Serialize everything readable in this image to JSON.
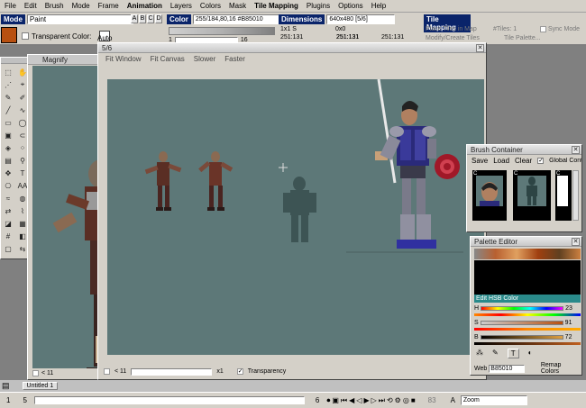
{
  "menu": [
    "File",
    "Edit",
    "Brush",
    "Mode",
    "Frame",
    "Animation",
    "Layers",
    "Colors",
    "Mask",
    "Tile Mapping",
    "Plugins",
    "Options",
    "Help"
  ],
  "toolbar": {
    "mode_label": "Mode",
    "mode_value": "Paint",
    "abcd": [
      "A",
      "B",
      "C",
      "D"
    ],
    "transparent_color": "Transparent Color:",
    "auto": "Auto",
    "color_label": "Color",
    "color_value": "255/184,80,16 #B85010",
    "color_index": "1",
    "color_count": "16",
    "dimensions_label": "Dimensions",
    "dimensions_value": "640x480 [5/6]",
    "brush_size": "1x1 S",
    "offset": "0x0",
    "coords": [
      "251:131",
      "251:131",
      "251:131",
      "251:131"
    ],
    "tilemapping_label": "Tile Mapping",
    "place_tiles": "Place Tiles in Map",
    "modify_tiles": "Modify/Create Tiles",
    "tiles_count": "#Tiles: 1",
    "tile_palette": "Tile Palette...",
    "sync_mode": "Sync Mode"
  },
  "magnify": {
    "title": "Magnify",
    "zoom": "< 11"
  },
  "canvas_window": {
    "title": "5/6",
    "menu": [
      "Fit Window",
      "Fit Canvas",
      "Slower",
      "Faster"
    ],
    "zoom": "< 11",
    "zoom_right": "x1",
    "transparency": "Transparency"
  },
  "brush_container": {
    "title": "Brush Container",
    "menu": [
      "Save",
      "Load",
      "Clear"
    ],
    "global": "Global Container",
    "slots": [
      "C",
      "C",
      "C"
    ]
  },
  "palette_editor": {
    "title": "Palette Editor",
    "hsb_label": "Edit HSB Color",
    "h_label": "H",
    "h_value": "23",
    "s_label": "S",
    "s_value": "91",
    "b_label": "B",
    "b_value": "72",
    "web_label": "Web",
    "web_value": "B85010",
    "remap": "Remap Colors"
  },
  "tab": {
    "label": "Untitled 1"
  },
  "status": {
    "frame": "1",
    "total": "5",
    "frame_right": "6",
    "page": "83",
    "zoom_letter": "A",
    "zoom_value": "Zoom"
  },
  "colors": {
    "accent": "#0a246a",
    "canvas_bg": "#5d7878",
    "fg_color": "#b85010"
  }
}
